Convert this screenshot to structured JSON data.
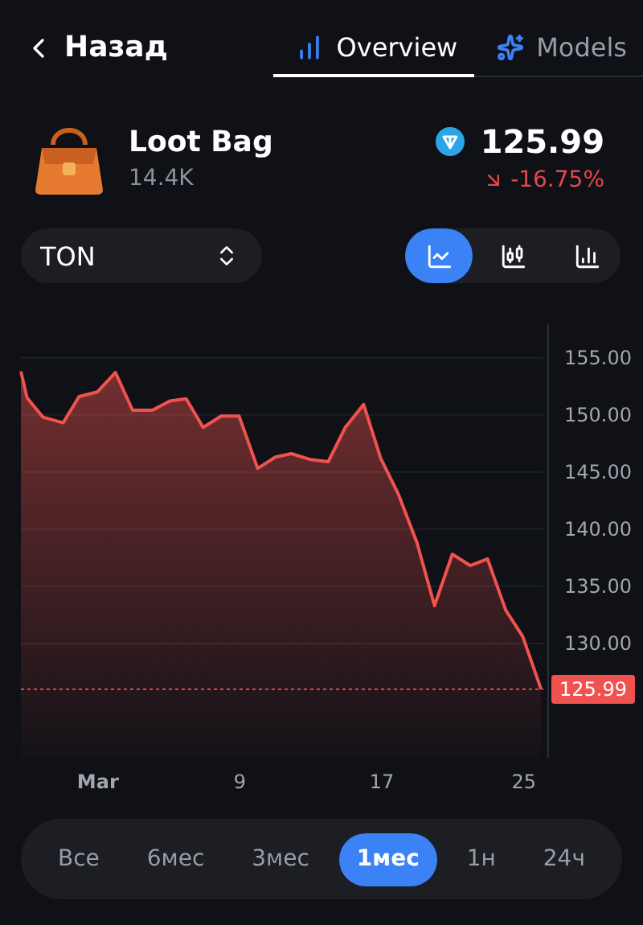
{
  "header": {
    "back": "Назад",
    "tabs": [
      {
        "label": "Overview",
        "selected": true
      },
      {
        "label": "Models",
        "selected": false
      }
    ]
  },
  "item": {
    "name": "Loot Bag",
    "count": "14.4K",
    "price": "125.99",
    "change": "-16.75%",
    "falling": true
  },
  "currency": {
    "value": "TON"
  },
  "chart_types": [
    {
      "kind": "line",
      "selected": true
    },
    {
      "kind": "candles",
      "selected": false
    },
    {
      "kind": "bars",
      "selected": false
    }
  ],
  "chart": {
    "chart_data": {
      "type": "area",
      "x": [
        -3.34,
        -3.0,
        -2.1,
        -0.96,
        -0.06,
        0.97,
        1.99,
        2.96,
        4.07,
        5.06,
        5.97,
        6.93,
        7.95,
        8.95,
        10.0,
        11.0,
        11.9,
        12.96,
        13.98,
        14.94,
        15.97,
        16.93,
        17.95,
        18.98,
        19.97,
        20.97,
        21.99,
        22.96,
        23.98,
        24.94,
        25.97
      ],
      "series": [
        {
          "color": "#f0524f",
          "values": [
            153.8,
            151.5,
            149.8,
            149.3,
            151.6,
            152.0,
            153.7,
            150.4,
            150.4,
            151.2,
            151.4,
            148.9,
            149.9,
            149.9,
            145.3,
            146.3,
            146.6,
            146.1,
            145.9,
            148.9,
            150.9,
            146.2,
            143.0,
            138.8,
            133.3,
            137.8,
            136.8,
            137.4,
            132.9,
            130.6,
            126.0
          ]
        }
      ],
      "xlim": [
        -3.34,
        26.1
      ],
      "ylim": [
        120,
        158
      ],
      "xticks": [
        {
          "value": 1,
          "label": "Mar"
        },
        9,
        17,
        25
      ],
      "yticks": [
        {
          "value": 130,
          "label": "130.00"
        },
        {
          "value": 135,
          "label": "135.00"
        },
        {
          "value": 140,
          "label": "140.00"
        },
        {
          "value": 145,
          "label": "145.00"
        },
        {
          "value": 150,
          "label": "150.00"
        },
        {
          "value": 155,
          "label": "155.00"
        }
      ],
      "grid": true,
      "ref_lines": [
        {
          "axis": "y",
          "value": 125.99,
          "label": "125.99"
        }
      ]
    }
  },
  "periods": [
    {
      "label": "Все",
      "selected": false
    },
    {
      "label": "6мес",
      "selected": false
    },
    {
      "label": "3мес",
      "selected": false
    },
    {
      "label": "1мес",
      "selected": true
    },
    {
      "label": "1н",
      "selected": false
    },
    {
      "label": "24ч",
      "selected": false
    }
  ]
}
